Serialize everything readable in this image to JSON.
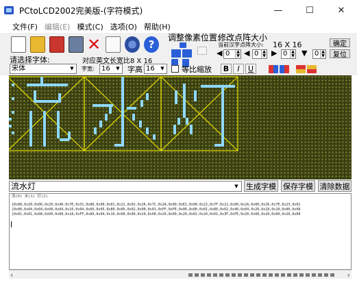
{
  "window": {
    "title": "PCtoLCD2002完美版-(字符模式)",
    "minimize": "—",
    "maximize": "☐",
    "close": "✕"
  },
  "menu": [
    {
      "label": "文件(F)",
      "disabled": false
    },
    {
      "label": "编辑(E)",
      "disabled": true
    },
    {
      "label": "模式(C)",
      "disabled": false
    },
    {
      "label": "选项(O)",
      "disabled": false
    },
    {
      "label": "帮助(H)",
      "disabled": false
    }
  ],
  "toolbar": {
    "icons": [
      "new-file-icon",
      "open-folder-icon",
      "save-icon",
      "print-icon",
      "delete-icon",
      "document-icon",
      "settings-gear-icon",
      "help-icon"
    ],
    "font_label": "请选择字体:",
    "font_value": "宋体",
    "size_label": "字宽:",
    "width_value": "16",
    "char_size_label": "对应英文长宽比8 X 16",
    "height_label": "字高",
    "height_value": "16",
    "scale_label": "等比缩放",
    "adjust_label": "调整像素位置:",
    "matrix_label": "修改点阵大小",
    "matrix_current_label": "当前汉字点阵大小:",
    "matrix_current_value": "16 X 16",
    "confirm_button": "确定",
    "reset_button": "复位",
    "spin_values": [
      "0",
      "0",
      "0",
      "0"
    ],
    "bold": "B",
    "italic": "I",
    "underline": "U"
  },
  "input": {
    "text": "流水灯"
  },
  "buttons": {
    "generate": "生成字模",
    "save": "保存字模",
    "clear": "清除数据"
  },
  "output": {
    "header": "流(0) 水(1) 灯(2)",
    "lines": [
      "{0x08,0x20,0x06,0x20,0x40,0x7E,0x31,0x80,0x00,0x01,0x22,0x02,0x26,0x7C,0x2A,0x00,0xE2,0x00,0x22,0x7F,0x22,0x00,0x2A,0x00,0x26,0x7E,0x23,0x01",
      "{0x00,0x04,0x04,0x08,0x04,0x10,0x04,0x60,0x05,0x80,0x06,0x02,0x00,0x01,0xFF,0xFE,0x06,0x00,0x01,0x80,0x02,0x40,0x04,0x20,0x18,0x10,0x00,0x08",
      "{0x01,0x01,0x08,0x00,0x00,0x18,0xFF,0x80,0x04,0x10,0x08,0x00,0x20,0x00,0x20,0x00,0x20,0x02,0x20,0x01,0x3F,0xFE,0x20,0x00,0x20,0x00,0x20,0x00"
    ]
  }
}
